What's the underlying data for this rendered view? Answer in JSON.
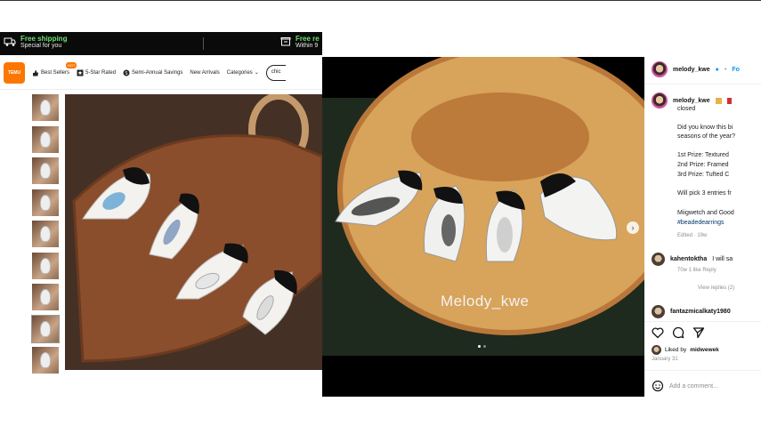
{
  "temu": {
    "promo": {
      "shipping_title": "Free shipping",
      "shipping_sub": "Special for you",
      "returns_title": "Free re",
      "returns_sub": "Within 9"
    },
    "logo": "TEMU",
    "nav": {
      "best_sellers": "Best Sellers",
      "hot_badge": "HOT",
      "five_star": "5-Star Rated",
      "semi_annual": "Semi-Annual Savings",
      "new_arrivals": "New Arrivals",
      "categories": "Categories",
      "search": "chic"
    }
  },
  "instagram": {
    "header": {
      "username": "melody_kwe",
      "separator": "•",
      "follow": "Fo"
    },
    "caption": {
      "username": "melody_kwe",
      "status": "closed",
      "line1": "Did you know this bi",
      "line2": "seasons of the year?",
      "prize1": "1st Prize: Textured",
      "prize2": "2nd Prize: Framed",
      "prize3": "3rd Prize: Tufted C",
      "line3": "Will pick 3 entries fr",
      "line4": "Miigwetch and Good",
      "hashtag": "#beadedearrings",
      "meta": "Edited · 19w"
    },
    "comment1": {
      "username": "kahentoktha",
      "text": "I will sa",
      "meta": "70w  1 like  Reply",
      "view_replies": "View replies (2)"
    },
    "comment2": {
      "username": "fantazmicalkaty1980"
    },
    "likes": {
      "text": "Liked by",
      "user": "midwewek"
    },
    "date": "January 31",
    "add_comment_placeholder": "Add a comment..."
  },
  "photo": {
    "watermark": "Melody_kwe"
  },
  "colors": {
    "temu_orange": "#fb7701",
    "promo_green": "#6ee06e",
    "insta_blue": "#0095f6"
  }
}
